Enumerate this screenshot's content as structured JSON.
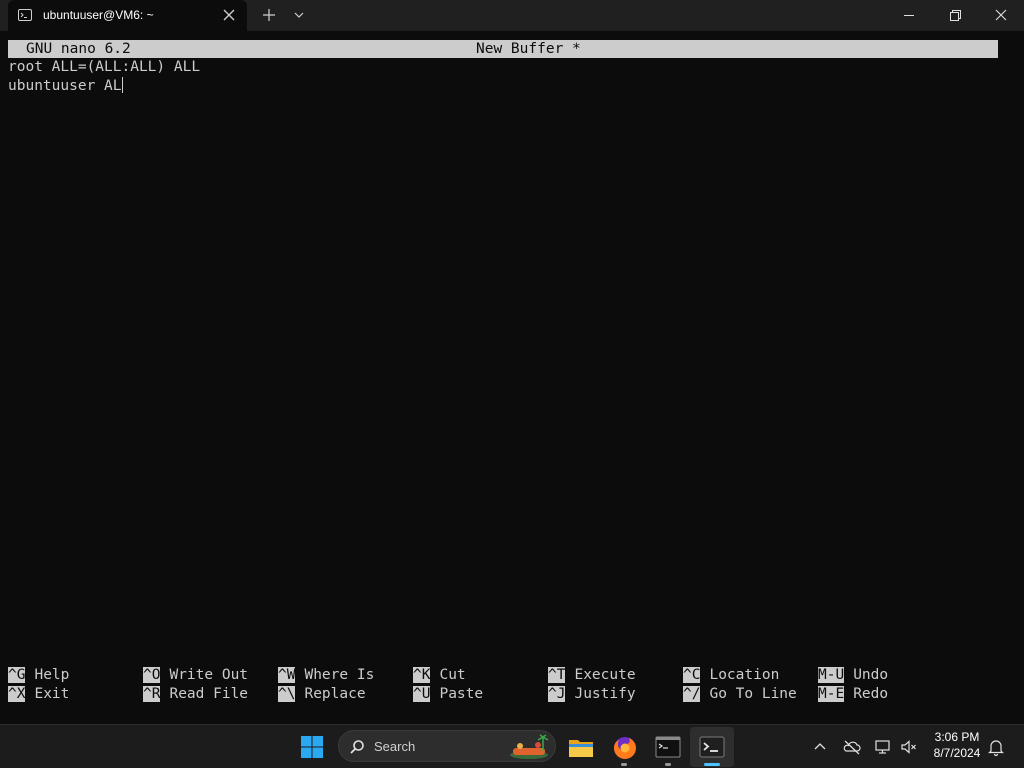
{
  "window": {
    "tab_title": "ubuntuuser@VM6: ~",
    "tab_icon": "terminal-icon"
  },
  "nano": {
    "version": "GNU nano 6.2",
    "buffer": "New Buffer *",
    "lines": [
      "root ALL=(ALL:ALL) ALL",
      "ubuntuuser AL"
    ],
    "shortcuts_row1": [
      {
        "key": "^G",
        "label": "Help"
      },
      {
        "key": "^O",
        "label": "Write Out"
      },
      {
        "key": "^W",
        "label": "Where Is"
      },
      {
        "key": "^K",
        "label": "Cut"
      },
      {
        "key": "^T",
        "label": "Execute"
      },
      {
        "key": "^C",
        "label": "Location"
      },
      {
        "key": "M-U",
        "label": "Undo"
      }
    ],
    "shortcuts_row2": [
      {
        "key": "^X",
        "label": "Exit"
      },
      {
        "key": "^R",
        "label": "Read File"
      },
      {
        "key": "^\\",
        "label": "Replace"
      },
      {
        "key": "^U",
        "label": "Paste"
      },
      {
        "key": "^J",
        "label": "Justify"
      },
      {
        "key": "^/",
        "label": "Go To Line"
      },
      {
        "key": "M-E",
        "label": "Redo"
      }
    ]
  },
  "taskbar": {
    "search_label": "Search",
    "time": "3:06 PM",
    "date": "8/7/2024"
  },
  "colors": {
    "terminal_bg": "#0c0c0c",
    "terminal_fg": "#cccccc",
    "titlebar_bg": "#202020",
    "taskbar_bg": "#1c1c1c",
    "accent": "#4cc2ff"
  }
}
